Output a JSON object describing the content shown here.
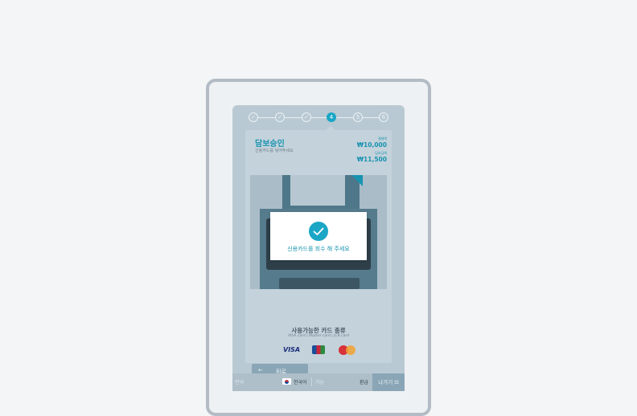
{
  "steps": [
    "✓",
    "✓",
    "✓",
    "4",
    "5",
    "6"
  ],
  "page": {
    "title": "담보승인",
    "subtitle": "신용카드를 넣어주세요",
    "amount1_label": "결제액",
    "amount1": "₩10,000",
    "amount2_label": "담보금액",
    "amount2": "₩11,500"
  },
  "modal": {
    "message": "신용카드를 회수 해 주세요"
  },
  "supported": {
    "title": "사용가능한 카드 종류",
    "subtitle": "VISA card | Master card | JCB card",
    "logos": {
      "visa": "VISA"
    }
  },
  "back_button": {
    "label": "뒤로"
  },
  "footer": {
    "left": "언어",
    "language": "한국어",
    "mid": "기능",
    "refund": "환급",
    "exit": "나가기 ⊡"
  },
  "colors": {
    "accent": "#1ba6c6",
    "overlay": "#b9c9d3"
  }
}
